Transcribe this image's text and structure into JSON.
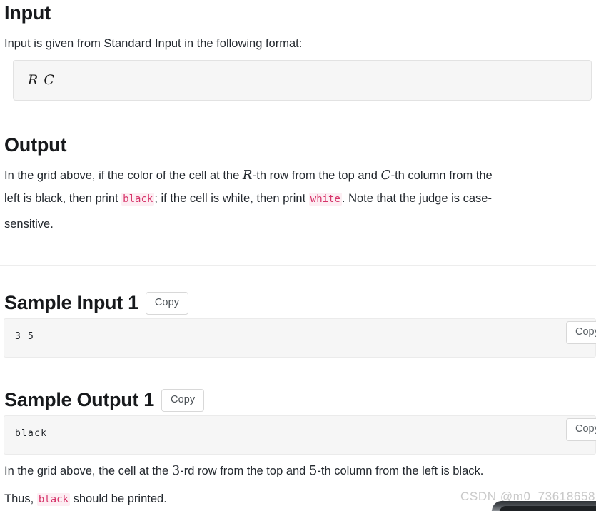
{
  "sections": {
    "input": {
      "heading": "Input",
      "intro": "Input is given from Standard Input in the following format:",
      "format_text": "R  C"
    },
    "output": {
      "heading": "Output",
      "line1_a": "In the grid above, if the color of the cell at the ",
      "var_r": "R",
      "line1_b": "-th row from the top and ",
      "var_c": "C",
      "line1_c": "-th column from the",
      "line2_a": "left is black, then print ",
      "code_black": "black",
      "line2_b": "; if the cell is white, then print ",
      "code_white": "white",
      "line2_c": ". Note that the judge is case-",
      "line3": "sensitive."
    }
  },
  "sample_input": {
    "heading": "Sample Input 1",
    "copy_label": "Copy",
    "inner_copy_label": "Copy",
    "content": "3 5"
  },
  "sample_output": {
    "heading": "Sample Output 1",
    "copy_label": "Copy",
    "inner_copy_label": "Copy",
    "content": "black"
  },
  "explanation": {
    "line1_a": "In the grid above, the cell at the ",
    "num_row": "3",
    "line1_b": "-rd row from the top and ",
    "num_col": "5",
    "line1_c": "-th column from the left is black.",
    "line2_a": "Thus, ",
    "code_black": "black",
    "line2_b": " should be printed."
  },
  "watermark": {
    "text": "CSDN @m0_73618658"
  },
  "colors": {
    "inline_code_text": "#d63369",
    "inline_code_bg": "#fdeef3",
    "code_block_bg": "#f6f6f6",
    "text": "#24292f"
  }
}
